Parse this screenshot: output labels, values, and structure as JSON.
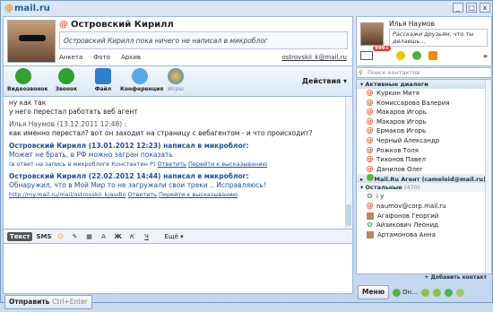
{
  "app": {
    "logo_at": "@",
    "logo_text": "mail.ru"
  },
  "window_controls": {
    "minimize": "_",
    "maximize": "□",
    "close": "x"
  },
  "contact": {
    "name": "Островский Кирилл",
    "status": "Островский Кирилл пока ничего не написал в микроблог",
    "links": [
      "Анкета",
      "Фото",
      "Архив"
    ],
    "email": "ostrovskii_k@mail.ru"
  },
  "toolbar": {
    "video": "Видеозвонок",
    "call": "Звонок",
    "file": "Файл",
    "conference": "Конференция",
    "games": "Игры",
    "actions": "Действия"
  },
  "messages": [
    {
      "type": "plain",
      "lines": [
        "ну как так",
        "у него перестал работать веб агент"
      ]
    },
    {
      "type": "msg",
      "sender": "Илья Наумов (13.12.2011 12:48) :",
      "text": "как именно перестал? вот он заходит на страницу с вебагентом - и что происходит?"
    },
    {
      "type": "blog",
      "sender": "Островский Кирилл (13.01.2012 12:23) написал в микроблог:",
      "text": "Может не брать, в РФ можно загран показать",
      "sub_prefix": "(в ответ на запись в микроблоге Константин Р)",
      "reply": "Ответить",
      "goto": "Перейти к высказыванию"
    },
    {
      "type": "blog",
      "sender": "Островский Кирилл (22.02.2012 14:44) написал в микроблог:",
      "text": "Обнаружил, что в Мой Мир то  не загружали свои треки .. Исправляюсь!",
      "link": "http://my.mail.ru/mail/ostrovskii_k/audio",
      "reply": "Ответить",
      "goto": "Перейти к высказыванию"
    }
  ],
  "format_bar": {
    "text_tab": "Текст",
    "sms_tab": "SMS",
    "bold": "Ж",
    "italic": "К",
    "underline": "Ч",
    "more": "Ещё"
  },
  "send": {
    "label": "Отправить",
    "hint": "Ctrl+Enter"
  },
  "me": {
    "name": "Илья Наумов",
    "status": "Расскажи друзьям, что ты делаешь...",
    "mail_badge": "999+",
    "more": "»"
  },
  "search": {
    "placeholder": "Поиск контактов"
  },
  "groups": {
    "active": {
      "label": "Активные диалоги"
    },
    "agent": {
      "label": "Mail.Ru Агент (cameloid@mail.ru)"
    },
    "others": {
      "label": "Остальные",
      "count": "(470)"
    }
  },
  "active_contacts": [
    "Куркин Митя",
    "Комиссарова Валерия",
    "Макаров Игорь",
    "Макаров Игорь",
    "Ермаков Игорь",
    "Черный Александр",
    "Рожков Толя",
    "Тихонов Павел",
    "Данилов Олег"
  ],
  "other_contacts": [
    "i y",
    "naumov@corp.mail.ru",
    "Агафонов Георгий",
    "Айзикович Леонид",
    "Артамонова Анна"
  ],
  "add_contact": "+ Добавить контакт",
  "bottom": {
    "menu": "Меню",
    "status": "Он..."
  }
}
